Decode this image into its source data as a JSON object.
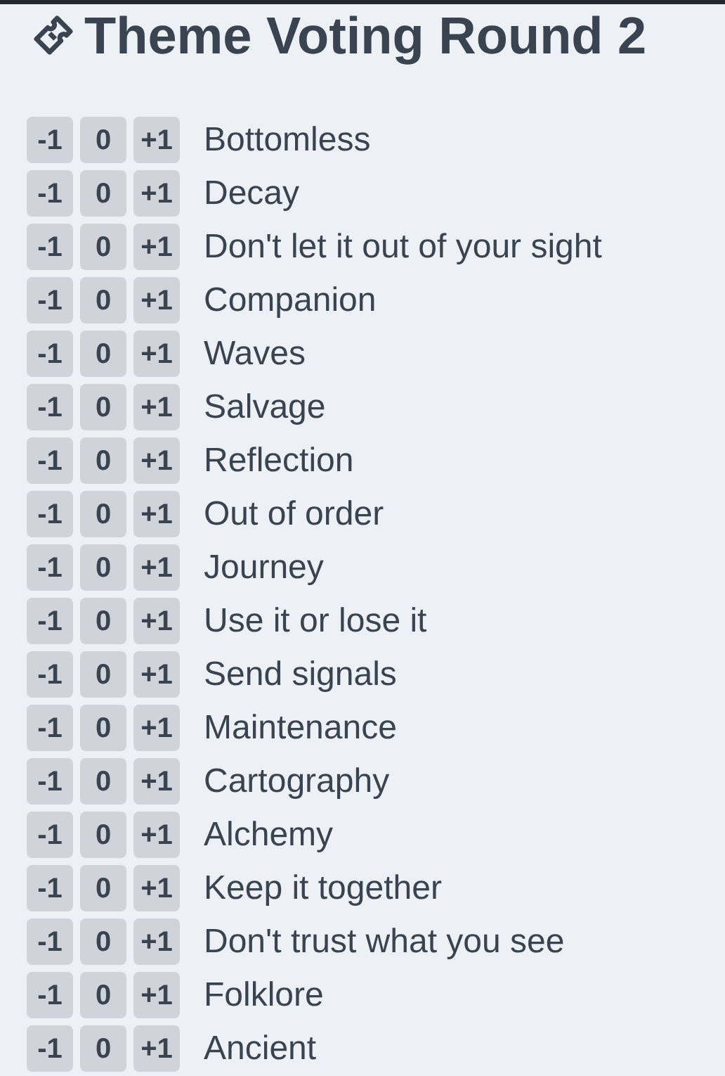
{
  "title": "Theme Voting Round 2",
  "themes": [
    {
      "name": "Bottomless",
      "votes": [
        "-1",
        "0",
        "+1"
      ]
    },
    {
      "name": "Decay",
      "votes": [
        "-1",
        "0",
        "+1"
      ]
    },
    {
      "name": "Don't let it out of your sight",
      "votes": [
        "-1",
        "0",
        "+1"
      ]
    },
    {
      "name": "Companion",
      "votes": [
        "-1",
        "0",
        "+1"
      ]
    },
    {
      "name": "Waves",
      "votes": [
        "-1",
        "0",
        "+1"
      ]
    },
    {
      "name": "Salvage",
      "votes": [
        "-1",
        "0",
        "+1"
      ]
    },
    {
      "name": "Reflection",
      "votes": [
        "-1",
        "0",
        "+1"
      ]
    },
    {
      "name": "Out of order",
      "votes": [
        "-1",
        "0",
        "+1"
      ]
    },
    {
      "name": "Journey",
      "votes": [
        "-1",
        "0",
        "+1"
      ]
    },
    {
      "name": "Use it or lose it",
      "votes": [
        "-1",
        "0",
        "+1"
      ]
    },
    {
      "name": "Send signals",
      "votes": [
        "-1",
        "0",
        "+1"
      ]
    },
    {
      "name": "Maintenance",
      "votes": [
        "-1",
        "0",
        "+1"
      ]
    },
    {
      "name": "Cartography",
      "votes": [
        "-1",
        "0",
        "+1"
      ]
    },
    {
      "name": "Alchemy",
      "votes": [
        "-1",
        "0",
        "+1"
      ]
    },
    {
      "name": "Keep it together",
      "votes": [
        "-1",
        "0",
        "+1"
      ]
    },
    {
      "name": "Don't trust what you see",
      "votes": [
        "-1",
        "0",
        "+1"
      ]
    },
    {
      "name": "Folklore",
      "votes": [
        "-1",
        "0",
        "+1"
      ]
    },
    {
      "name": "Ancient",
      "votes": [
        "-1",
        "0",
        "+1"
      ]
    }
  ]
}
